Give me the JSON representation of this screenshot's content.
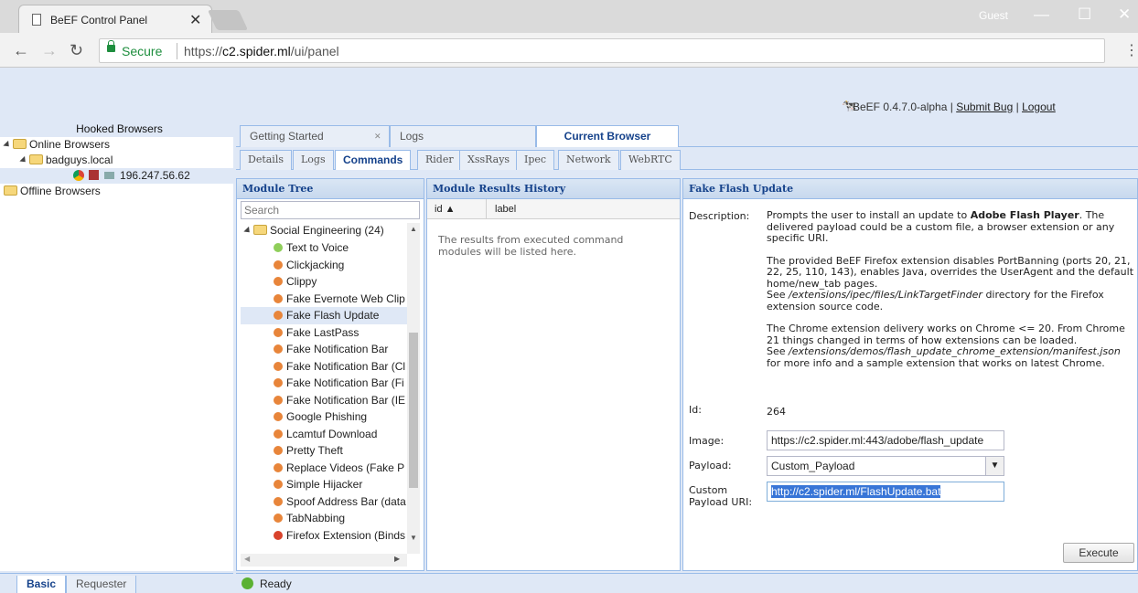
{
  "browser": {
    "tab_title": "BeEF Control Panel",
    "tab_close": "✕",
    "user": "Guest",
    "secure_label": "Secure",
    "url_scheme": "https://",
    "url_host": "c2.spider.ml",
    "url_path": "/ui/panel"
  },
  "beef_header": {
    "version": "BeEF  0.4.7.0-alpha  |",
    "submit_bug": "Submit  Bug",
    "sep": "|",
    "logout": "Logout"
  },
  "hooked": {
    "title": "Hooked Browsers",
    "online": "Online Browsers",
    "domain": "badguys.local",
    "ip": "196.247.56.62",
    "offline": "Offline Browsers"
  },
  "bottom_tabs": {
    "basic": "Basic",
    "requester": "Requester"
  },
  "status": {
    "text": "Ready"
  },
  "main_tabs": [
    {
      "label": "Getting Started"
    },
    {
      "label": "Logs"
    },
    {
      "label": "Current Browser"
    }
  ],
  "sub_tabs": [
    "Details",
    "Logs",
    "Commands",
    "Rider",
    "XssRays",
    "Ipec",
    "Network",
    "WebRTC"
  ],
  "module_tree": {
    "title": "Module Tree",
    "search_placeholder": "Search",
    "category": "Social Engineering (24)",
    "modules": [
      {
        "label": "Text to Voice",
        "color": "#8fce5a"
      },
      {
        "label": "Clickjacking",
        "color": "#e8853a"
      },
      {
        "label": "Clippy",
        "color": "#e8853a"
      },
      {
        "label": "Fake Evernote Web Clip",
        "color": "#e8853a"
      },
      {
        "label": "Fake Flash Update",
        "color": "#e8853a"
      },
      {
        "label": "Fake LastPass",
        "color": "#e8853a"
      },
      {
        "label": "Fake Notification Bar",
        "color": "#e8853a"
      },
      {
        "label": "Fake Notification Bar (Cl",
        "color": "#e8853a"
      },
      {
        "label": "Fake Notification Bar (Fi",
        "color": "#e8853a"
      },
      {
        "label": "Fake Notification Bar (IE",
        "color": "#e8853a"
      },
      {
        "label": "Google Phishing",
        "color": "#e8853a"
      },
      {
        "label": "Lcamtuf Download",
        "color": "#e8853a"
      },
      {
        "label": "Pretty Theft",
        "color": "#e8853a"
      },
      {
        "label": "Replace Videos (Fake P",
        "color": "#e8853a"
      },
      {
        "label": "Simple Hijacker",
        "color": "#e8853a"
      },
      {
        "label": "Spoof Address Bar (data",
        "color": "#e8853a"
      },
      {
        "label": "TabNabbing",
        "color": "#e8853a"
      },
      {
        "label": "Firefox Extension (Binds",
        "color": "#d9432c"
      }
    ]
  },
  "results": {
    "title": "Module Results History",
    "col_id": "id ▲",
    "col_label": "label",
    "empty": "The results from executed command modules will be listed here."
  },
  "detail": {
    "title": "Fake Flash Update",
    "description_label": "Description:",
    "desc_p1a": "Prompts the user to install an update to ",
    "desc_p1b": "Adobe Flash Player",
    "desc_p1c": ". The delivered payload could be a custom file, a browser extension or any specific URI.",
    "desc_p2a": "The provided BeEF Firefox extension disables PortBanning (ports 20, 21, 22, 25, 110, 143), enables Java, overrides the UserAgent and the default home/new_tab pages.",
    "desc_p2b_see": "See ",
    "desc_p2b_path": "/extensions/ipec/files/LinkTargetFinder",
    "desc_p2b_rest": " directory for the Firefox extension source code.",
    "desc_p3a": "The Chrome extension delivery works on Chrome <= 20. From Chrome 21 things changed in terms of how extensions can be loaded.",
    "desc_p3b_see": "See ",
    "desc_p3b_path": "/extensions/demos/flash_update_chrome_extension/manifest.json",
    "desc_p3b_rest": " for more info and a sample extension that works on latest Chrome.",
    "id_label": "Id:",
    "id_value": "264",
    "image_label": "Image:",
    "image_value": "https://c2.spider.ml:443/adobe/flash_update",
    "payload_label": "Payload:",
    "payload_value": "Custom_Payload",
    "custom_label_1": "Custom",
    "custom_label_2": "Payload URI:",
    "custom_value": "http://c2.spider.ml/FlashUpdate.bat",
    "execute": "Execute"
  }
}
